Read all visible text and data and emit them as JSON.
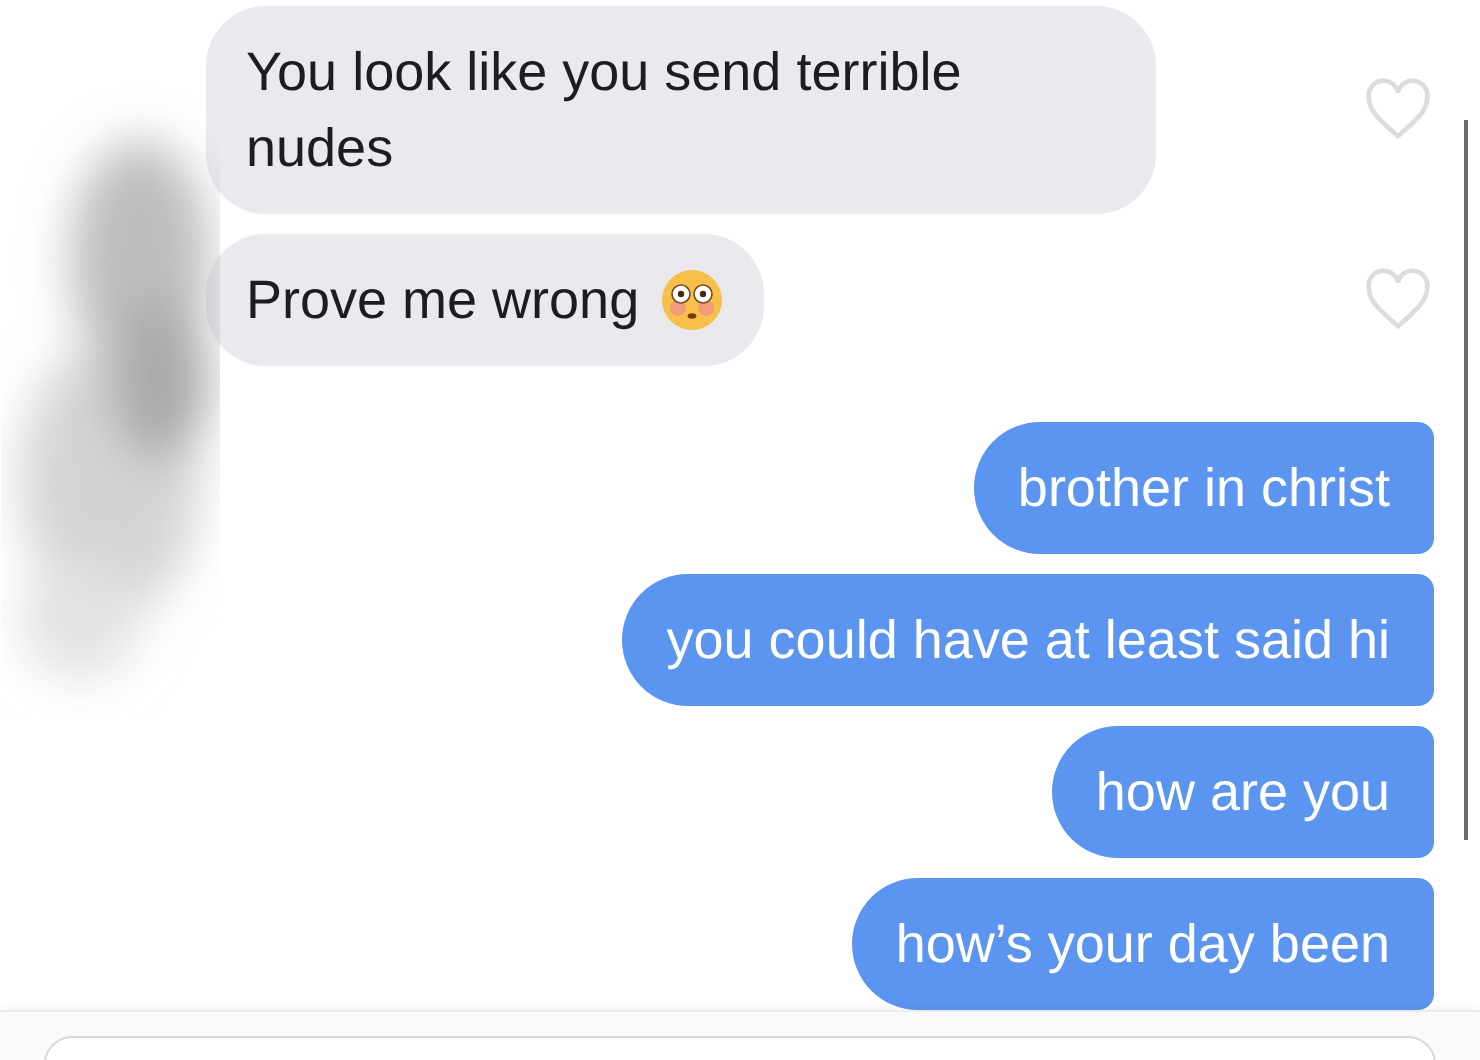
{
  "messages": [
    {
      "kind": "incoming",
      "text": "You look like you send terrible nudes",
      "emoji": false,
      "liked": false
    },
    {
      "kind": "incoming",
      "text": "Prove me wrong",
      "emoji": true,
      "liked": false
    },
    {
      "kind": "outgoing",
      "text": "brother in christ"
    },
    {
      "kind": "outgoing",
      "text": "you could have at least said hi"
    },
    {
      "kind": "outgoing",
      "text": "how are you"
    },
    {
      "kind": "outgoing",
      "text": "how’s your day been"
    }
  ]
}
